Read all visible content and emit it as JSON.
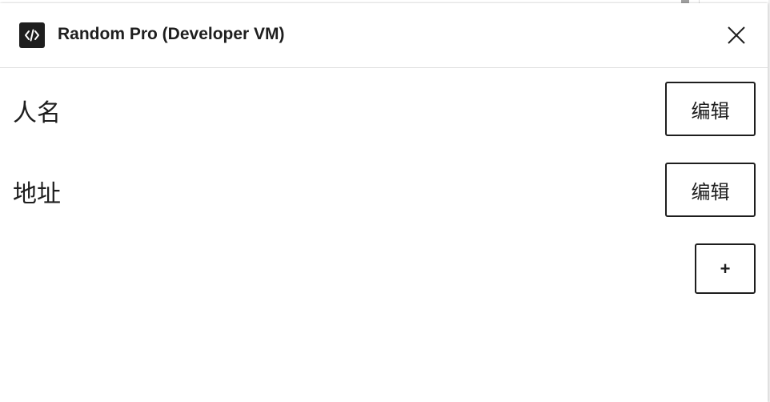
{
  "dialog": {
    "title": "Random Pro (Developer VM)",
    "app_icon": "code-icon",
    "close_icon": "close-icon"
  },
  "rows": [
    {
      "label": "人名",
      "button_label": "编辑"
    },
    {
      "label": "地址",
      "button_label": "编辑"
    }
  ],
  "add_button": {
    "label": "+"
  }
}
